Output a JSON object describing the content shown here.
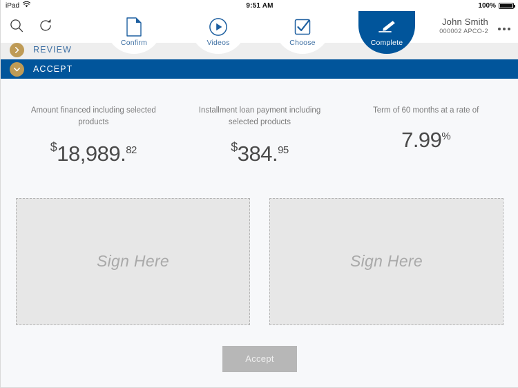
{
  "status_bar": {
    "device": "iPad",
    "wifi_icon": "wifi-icon",
    "time": "9:51 AM",
    "battery_percent": "100%",
    "battery_icon": "battery-full-icon"
  },
  "topbar": {
    "search_icon": "search-icon",
    "refresh_icon": "refresh-icon",
    "user_name": "John Smith",
    "user_id": "000002 APCO-2",
    "overflow_icon": "more-options-icon"
  },
  "steps": [
    {
      "label": "Confirm",
      "icon": "document-icon",
      "active": false
    },
    {
      "label": "Videos",
      "icon": "play-circle-icon",
      "active": false
    },
    {
      "label": "Choose",
      "icon": "checkbox-icon",
      "active": false
    },
    {
      "label": "Complete",
      "icon": "signature-pen-icon",
      "active": true
    }
  ],
  "sections": [
    {
      "title": "REVIEW",
      "state": "collapsed",
      "chevron_icon": "chevron-right-icon"
    },
    {
      "title": "ACCEPT",
      "state": "expanded",
      "chevron_icon": "chevron-down-icon"
    }
  ],
  "summary": [
    {
      "caption": "Amount financed including selected products",
      "currency": "$",
      "amount": "18,989.",
      "cents": "82",
      "suffix": ""
    },
    {
      "caption": "Installment loan payment including selected products",
      "currency": "$",
      "amount": "384.",
      "cents": "95",
      "suffix": ""
    },
    {
      "caption": "Term of 60 months at a rate of",
      "currency": "",
      "amount": "7.99",
      "cents": "",
      "suffix": "%"
    }
  ],
  "signature_pads": [
    {
      "placeholder": "Sign Here"
    },
    {
      "placeholder": "Sign Here"
    }
  ],
  "accept_button": {
    "label": "Accept",
    "enabled": false
  },
  "colors": {
    "brand_blue": "#01559b",
    "accent_gold": "#bf9b56",
    "page_bg": "#f7f8fa",
    "muted_text": "#7c7c7c",
    "disabled_button": "#b7b7b7"
  }
}
